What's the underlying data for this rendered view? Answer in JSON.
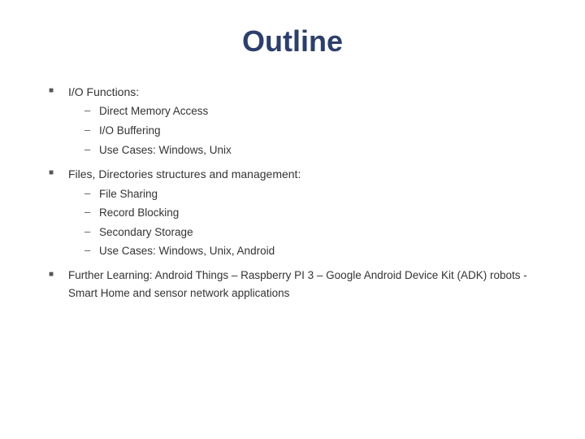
{
  "page": {
    "title": "Outline",
    "sections": [
      {
        "bullet": "■",
        "label": "I/O Functions:",
        "sub_items": [
          "Direct Memory Access",
          "I/O Buffering",
          "Use Cases: Windows, Unix"
        ]
      },
      {
        "bullet": "■",
        "label": "Files, Directories structures and management:",
        "sub_items": [
          "File Sharing",
          "Record Blocking",
          "Secondary Storage",
          "Use Cases: Windows, Unix, Android"
        ]
      },
      {
        "bullet": "■",
        "label": "Further Learning: Android Things – Raspberry PI 3 – Google Android Device Kit (ADK) robots  - Smart Home and sensor network applications",
        "sub_items": []
      }
    ]
  }
}
